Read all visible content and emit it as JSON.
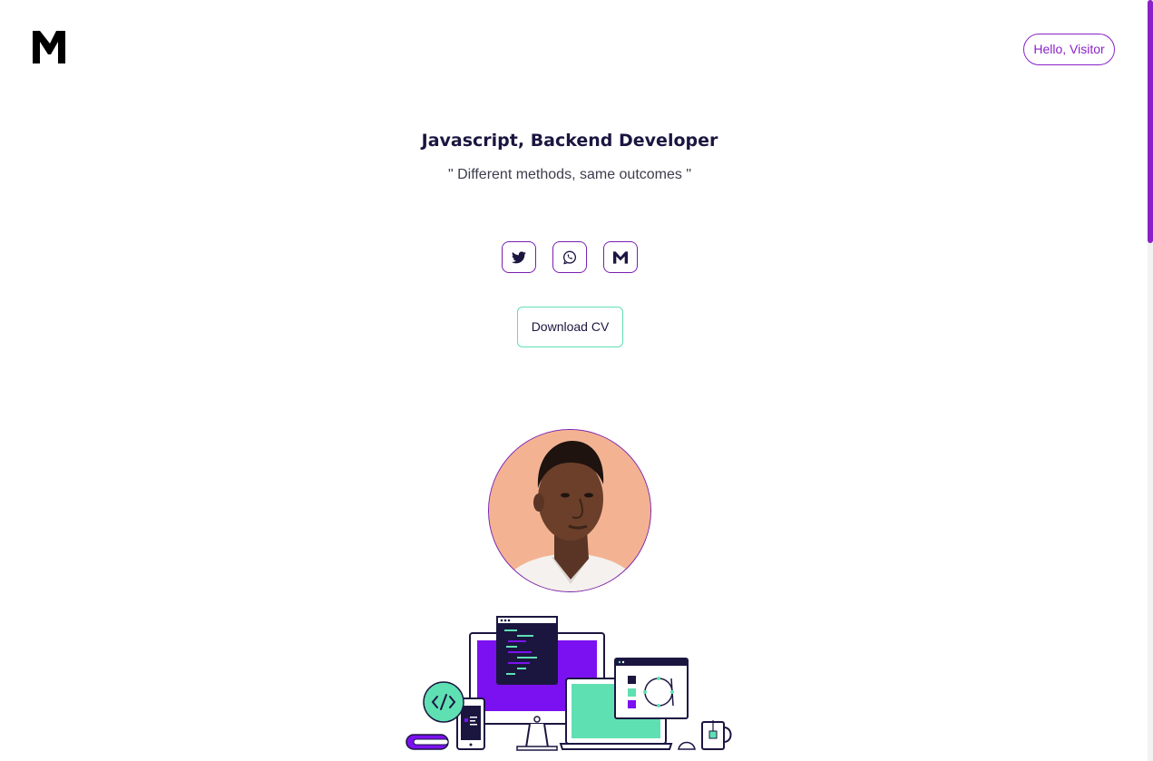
{
  "header": {
    "logo_alt": "M",
    "greeting_button": "Hello, Visitor"
  },
  "hero": {
    "title": "Javascript, Backend Developer",
    "tagline": "\" Different methods, same outcomes \""
  },
  "social": [
    {
      "name": "twitter",
      "icon": "twitter-icon"
    },
    {
      "name": "whatsapp",
      "icon": "whatsapp-icon"
    },
    {
      "name": "gmail",
      "icon": "gmail-icon"
    }
  ],
  "cv": {
    "label": "Download CV"
  },
  "colors": {
    "accent": "#8a22c8",
    "mint": "#5fe0b3",
    "navy": "#1b1640",
    "purple_screen": "#7b11f0"
  }
}
